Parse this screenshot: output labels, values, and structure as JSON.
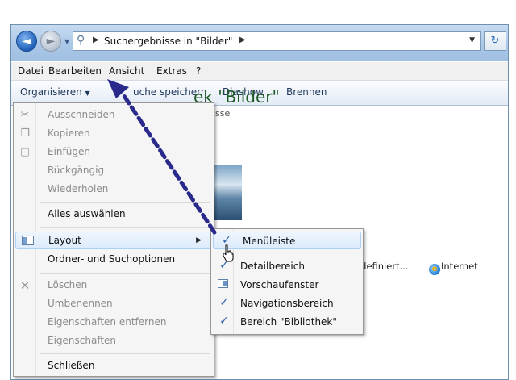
{
  "address": {
    "text": "Suchergebnisse in \"Bilder\""
  },
  "menubar": [
    "Datei",
    "Bearbeiten",
    "Ansicht",
    "Extras",
    "?"
  ],
  "toolbar": {
    "organize": "Organisieren",
    "save_search": "uche speichern",
    "slideshow": "Diashow",
    "burn": "Brennen"
  },
  "content": {
    "library_title": "ek \"Bilder\"",
    "library_subtitle": "isse",
    "network_item": "tzerdefiniert...",
    "internet": "Internet"
  },
  "organize_menu": {
    "items": [
      {
        "label": "Ausschneiden",
        "icon": "scissors-icon",
        "enabled": false
      },
      {
        "label": "Kopieren",
        "icon": "copy-icon",
        "enabled": false
      },
      {
        "label": "Einfügen",
        "icon": "paste-icon",
        "enabled": false
      },
      {
        "label": "Rückgängig",
        "icon": "",
        "enabled": false
      },
      {
        "label": "Wiederholen",
        "icon": "",
        "enabled": false
      },
      {
        "label": "Alles auswählen",
        "icon": "",
        "enabled": true
      },
      {
        "label": "Layout",
        "icon": "layout-icon",
        "enabled": true,
        "submenu": true
      },
      {
        "label": "Ordner- und Suchoptionen",
        "icon": "",
        "enabled": true
      },
      {
        "label": "Löschen",
        "icon": "delete-x-icon",
        "enabled": false
      },
      {
        "label": "Umbenennen",
        "icon": "",
        "enabled": false
      },
      {
        "label": "Eigenschaften entfernen",
        "icon": "",
        "enabled": false
      },
      {
        "label": "Eigenschaften",
        "icon": "",
        "enabled": false
      },
      {
        "label": "Schließen",
        "icon": "",
        "enabled": true
      }
    ]
  },
  "layout_submenu": {
    "items": [
      {
        "label": "Menüleiste",
        "checked": true
      },
      {
        "label": "Detailbereich",
        "checked": true
      },
      {
        "label": "Vorschaufenster",
        "checked": false
      },
      {
        "label": "Navigationsbereich",
        "checked": true
      },
      {
        "label": "Bereich \"Bibliothek\"",
        "checked": true
      }
    ]
  },
  "colors": {
    "annotation_arrow": "#2a2a8c",
    "library_title": "#1e5a26",
    "check": "#2b5fa6"
  }
}
